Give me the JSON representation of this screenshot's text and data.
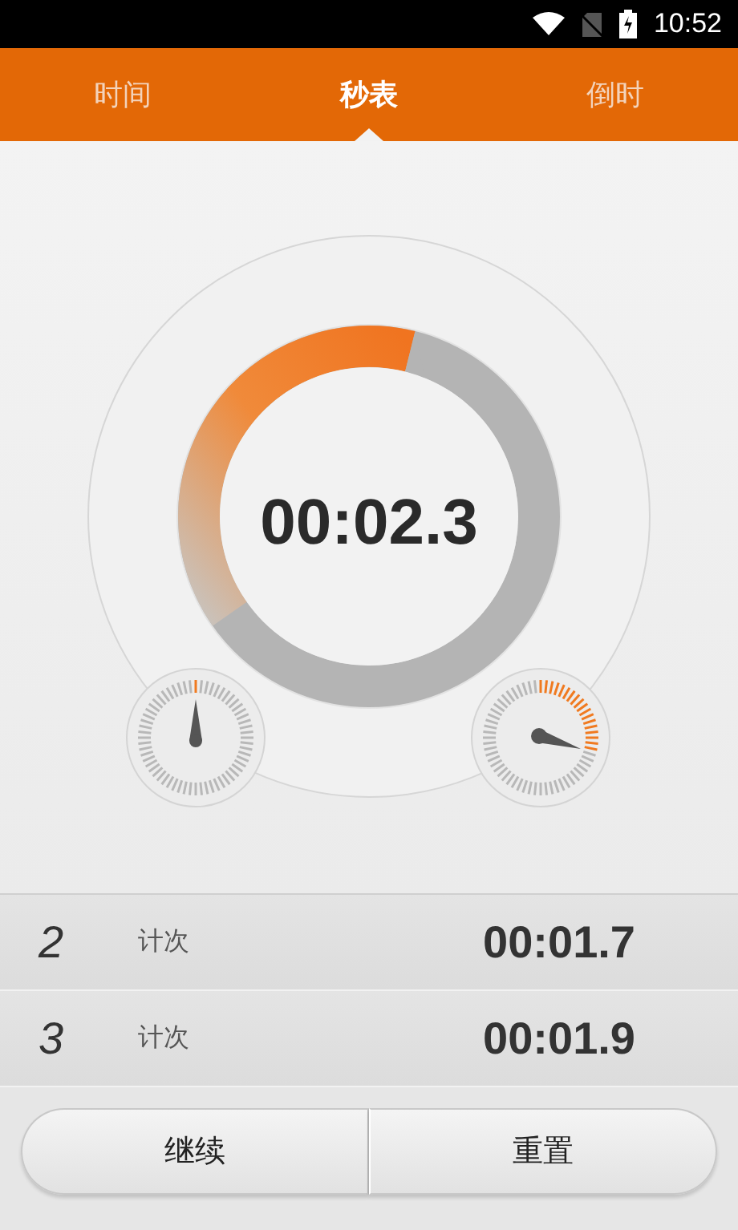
{
  "status_bar": {
    "time": "10:52"
  },
  "tabs": [
    {
      "label": "时间",
      "selected": false
    },
    {
      "label": "秒表",
      "selected": true
    },
    {
      "label": "倒时",
      "selected": false
    }
  ],
  "stopwatch": {
    "time": "00:02.3"
  },
  "laps": [
    {
      "number": "2",
      "label": "计次",
      "time": "00:01.7"
    },
    {
      "number": "3",
      "label": "计次",
      "time": "00:01.9"
    }
  ],
  "buttons": [
    "继续",
    "重置"
  ]
}
